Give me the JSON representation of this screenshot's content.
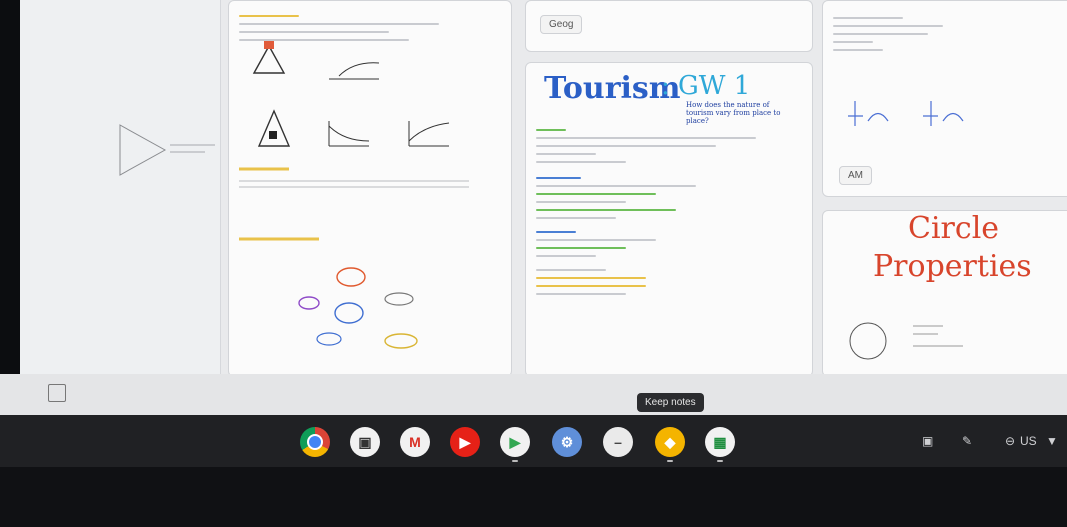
{
  "notes": {
    "chip_geog": "Geog",
    "chip_am": "AM",
    "tourism_title": "Tourism",
    "tourism_suffix": ": GW 1",
    "tourism_sub": "How does the nature of tourism vary from place to place?",
    "circle_title_1": "Circle",
    "circle_title_2": "Properties"
  },
  "tooltip": {
    "text": "Keep notes"
  },
  "shelf": {
    "apps": [
      {
        "name": "chrome"
      },
      {
        "name": "files"
      },
      {
        "name": "gmail"
      },
      {
        "name": "youtube"
      },
      {
        "name": "play-store"
      },
      {
        "name": "settings"
      },
      {
        "name": "app-minus"
      },
      {
        "name": "keep"
      },
      {
        "name": "classroom"
      }
    ]
  },
  "tray": {
    "locale": "US"
  },
  "colors": {
    "shelf_bg": "#202124",
    "screen_bg": "#e9eaec",
    "tourism_blue": "#2b5fc6",
    "tourism_cyan": "#2fa8d8",
    "circle_red": "#d8452c"
  }
}
